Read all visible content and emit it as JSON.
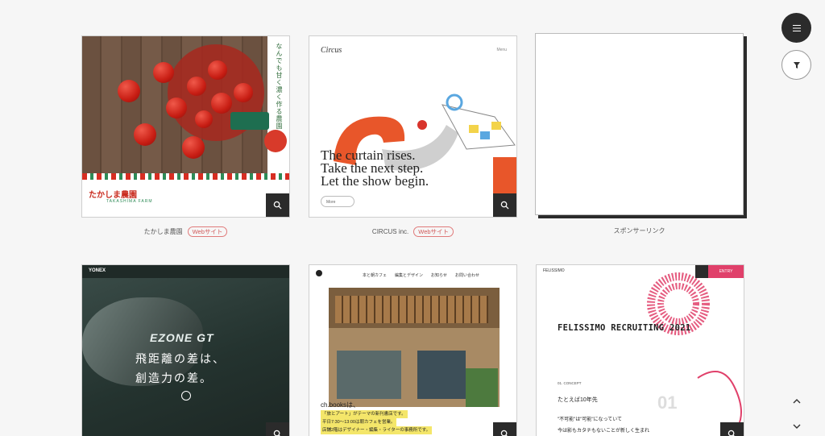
{
  "cards": [
    {
      "caption": "たかしま農園",
      "badge": "Webサイト",
      "thumb_tagline": "なんでも甘く濃く作る農園",
      "thumb_logo": "たかしま農園",
      "thumb_logo_sub": "TAKASHIMA FARM"
    },
    {
      "caption": "CIRCUS inc.",
      "badge": "Webサイト",
      "thumb_logo": "Circus",
      "thumb_menu": "Menu",
      "thumb_line1": "The curtain rises.",
      "thumb_line2": "Take the next step.",
      "thumb_line3": "Let the show begin.",
      "thumb_more": "More"
    },
    {
      "caption": "スポンサーリンク"
    },
    {
      "thumb_brand": "YONEX",
      "thumb_product": "EZONE GT",
      "thumb_copy1": "飛距離の差は、",
      "thumb_copy2": "創造力の差。"
    },
    {
      "thumb_nav": [
        "本と朝カフェ",
        "編集とデザイン",
        "お知らせ",
        "お問い合わせ"
      ],
      "thumb_title": "ch.booksは、",
      "thumb_lines": [
        "「旅とアート」がテーマの新刊書店です。",
        "平日7:30〜13:00は朝カフェを営業。",
        "店舗2階はデザイナー・編集・ライターの事務所です。"
      ]
    },
    {
      "thumb_logo": "FELISSIMO",
      "thumb_entry": "ENTRY",
      "thumb_title": "FELISSIMO RECRUITING 2021",
      "thumb_section": "01. CONCEPT",
      "thumb_lead": "たとえば10年先",
      "thumb_body1": "\"不可能\"は\"可能\"になっていて",
      "thumb_body2": "今は影もカタチもないことが新しく生まれ",
      "thumb_num": "01"
    }
  ],
  "icons": {
    "menu": "hamburger-icon",
    "filter": "filter-icon",
    "zoom": "search-icon",
    "up": "chevron-up-icon",
    "down": "chevron-down-icon"
  },
  "colors": {
    "accent": "#e0406a",
    "dark": "#2b2b2b",
    "badge": "#d05a5a"
  }
}
